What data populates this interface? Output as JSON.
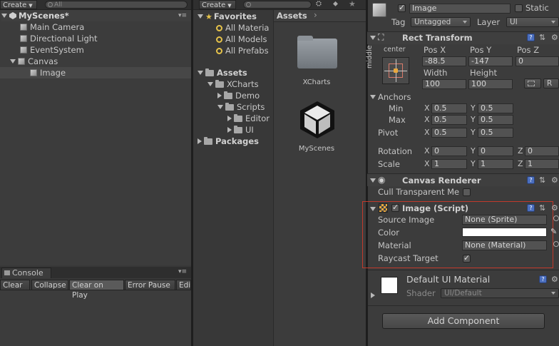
{
  "hierarchy": {
    "create_label": "Create",
    "search_placeholder": "All",
    "scene_name": "MyScenes*",
    "items": [
      {
        "label": "Main Camera"
      },
      {
        "label": "Directional Light"
      },
      {
        "label": "EventSystem"
      },
      {
        "label": "Canvas"
      },
      {
        "label": "Image"
      }
    ]
  },
  "console": {
    "tab_label": "Console",
    "buttons": [
      "Clear",
      "Collapse",
      "Clear on Play",
      "Error Pause",
      "Edit"
    ]
  },
  "project": {
    "create_label": "Create",
    "favorites_label": "Favorites",
    "favorites": [
      "All Materia",
      "All Models",
      "All Prefabs"
    ],
    "assets_label": "Assets",
    "tree": [
      "XCharts",
      "Demo",
      "Scripts",
      "Editor",
      "UI"
    ],
    "packages_label": "Packages",
    "breadcrumb": "Assets",
    "grid": [
      {
        "label": "XCharts"
      },
      {
        "label": "MyScenes"
      }
    ]
  },
  "inspector": {
    "object_name": "Image",
    "static_label": "Static",
    "tag_label": "Tag",
    "tag_value": "Untagged",
    "layer_label": "Layer",
    "layer_value": "UI",
    "rect_transform": {
      "title": "Rect Transform",
      "anchor_label": "center",
      "anchor_side": "middle",
      "pos_x_label": "Pos X",
      "pos_y_label": "Pos Y",
      "pos_z_label": "Pos Z",
      "pos_x": "-88.5",
      "pos_y": "-147",
      "pos_z": "0",
      "width_label": "Width",
      "height_label": "Height",
      "width": "100",
      "height": "100",
      "r_label": "R",
      "anchors_label": "Anchors",
      "min_label": "Min",
      "max_label": "Max",
      "min_x": "0.5",
      "min_y": "0.5",
      "max_x": "0.5",
      "max_y": "0.5",
      "pivot_label": "Pivot",
      "pivot_x": "0.5",
      "pivot_y": "0.5",
      "rotation_label": "Rotation",
      "rot_x": "0",
      "rot_y": "0",
      "rot_z": "0",
      "scale_label": "Scale",
      "scale_x": "1",
      "scale_y": "1",
      "scale_z": "1",
      "x": "X",
      "y": "Y",
      "z": "Z"
    },
    "canvas_renderer": {
      "title": "Canvas Renderer",
      "cull_label": "Cull Transparent Me"
    },
    "image_script": {
      "title": "Image (Script)",
      "source_image_label": "Source Image",
      "source_image_value": "None (Sprite)",
      "color_label": "Color",
      "color_value": "#ffffff",
      "material_label": "Material",
      "material_value": "None (Material)",
      "raycast_label": "Raycast Target"
    },
    "material_block": {
      "name": "Default UI Material",
      "shader_label": "Shader",
      "shader_value": "UI/Default"
    },
    "add_component_label": "Add Component"
  }
}
